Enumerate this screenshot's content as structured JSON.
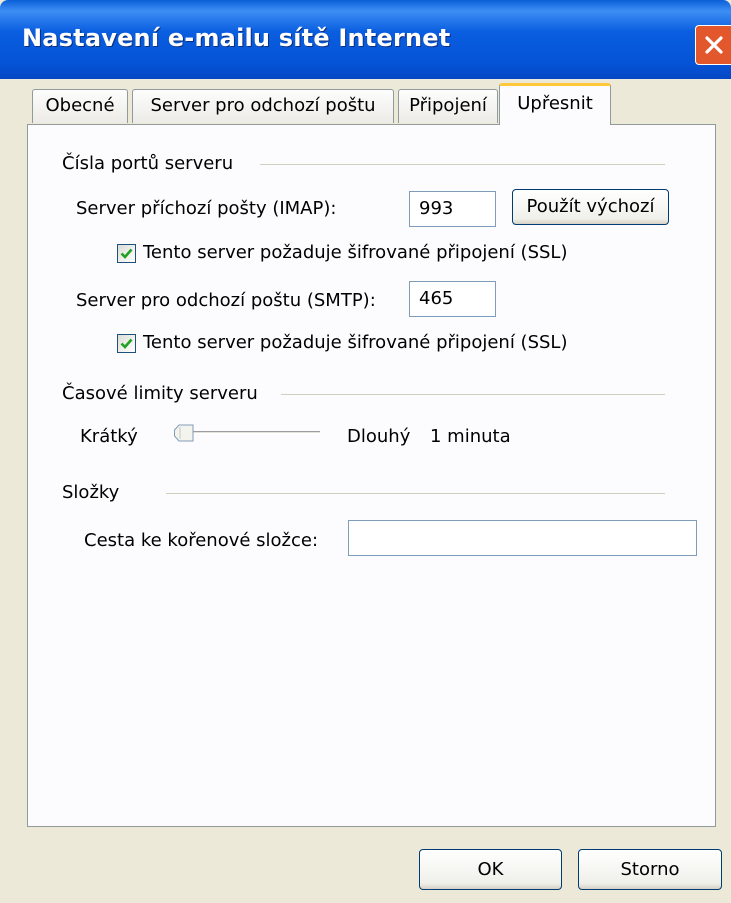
{
  "window": {
    "title": "Nastavení e-mailu sítě Internet"
  },
  "tabs": [
    {
      "label": "Obecné",
      "active": false
    },
    {
      "label": "Server pro odchozí poštu",
      "active": false
    },
    {
      "label": "Připojení",
      "active": false
    },
    {
      "label": "Upřesnit",
      "active": true
    }
  ],
  "ports": {
    "group_title": "Čísla portů serveru",
    "incoming_label": "Server příchozí pošty (IMAP):",
    "incoming_value": "993",
    "default_button": "Použít výchozí",
    "incoming_ssl_label": "Tento server požaduje šifrované připojení (SSL)",
    "incoming_ssl_checked": true,
    "outgoing_label": "Server pro odchozí poštu (SMTP):",
    "outgoing_value": "465",
    "outgoing_ssl_label": "Tento server požaduje šifrované připojení (SSL)",
    "outgoing_ssl_checked": true
  },
  "timeouts": {
    "group_title": "Časové limity serveru",
    "short_label": "Krátký",
    "long_label": "Dlouhý",
    "value_text": "1 minuta",
    "slider_level": 0.1
  },
  "folders": {
    "group_title": "Složky",
    "root_path_label": "Cesta ke kořenové složce:",
    "root_path_value": ""
  },
  "footer": {
    "ok_label": "OK",
    "cancel_label": "Storno"
  },
  "colors": {
    "titlebar": "#0a5ee0",
    "dialog_bg": "#ece9d8",
    "panel_bg": "#fcfcfe",
    "active_tab_accent": "#ffc83c",
    "check": "#21a121",
    "close": "#e3572c"
  }
}
